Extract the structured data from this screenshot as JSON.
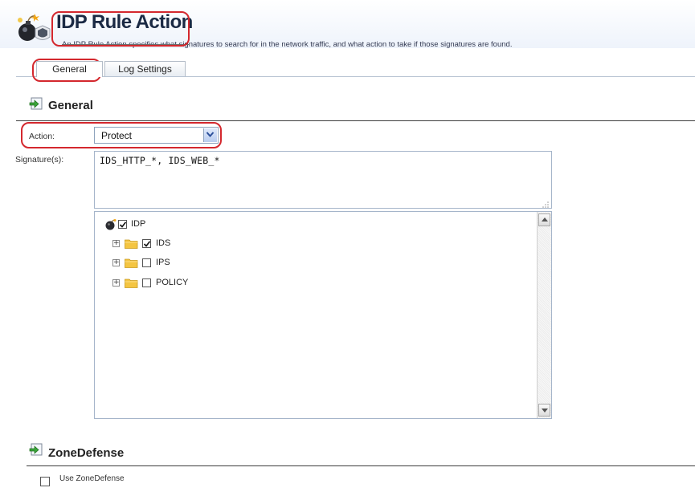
{
  "header": {
    "title": "IDP Rule Action",
    "description": "An IDP Rule Action specifies what signatures to search for in the network traffic, and what action to take if those signatures are found."
  },
  "tabs": [
    {
      "label": "General",
      "selected": true
    },
    {
      "label": "Log Settings",
      "selected": false
    }
  ],
  "general": {
    "title": "General",
    "action_label": "Action:",
    "action_value": "Protect",
    "signatures_label": "Signature(s):",
    "signatures_value": "IDS_HTTP_*, IDS_WEB_*"
  },
  "tree": {
    "root": {
      "label": "IDP",
      "checked": true
    },
    "items": [
      {
        "label": "IDS",
        "checked": true
      },
      {
        "label": "IPS",
        "checked": false
      },
      {
        "label": "POLICY",
        "checked": false
      }
    ]
  },
  "zonedefense": {
    "title": "ZoneDefense",
    "use_label": "Use ZoneDefense",
    "use_checked": false
  },
  "colors": {
    "callout": "#d4282e",
    "folder": "#f4c542",
    "header_bg": "#eef3fb"
  }
}
